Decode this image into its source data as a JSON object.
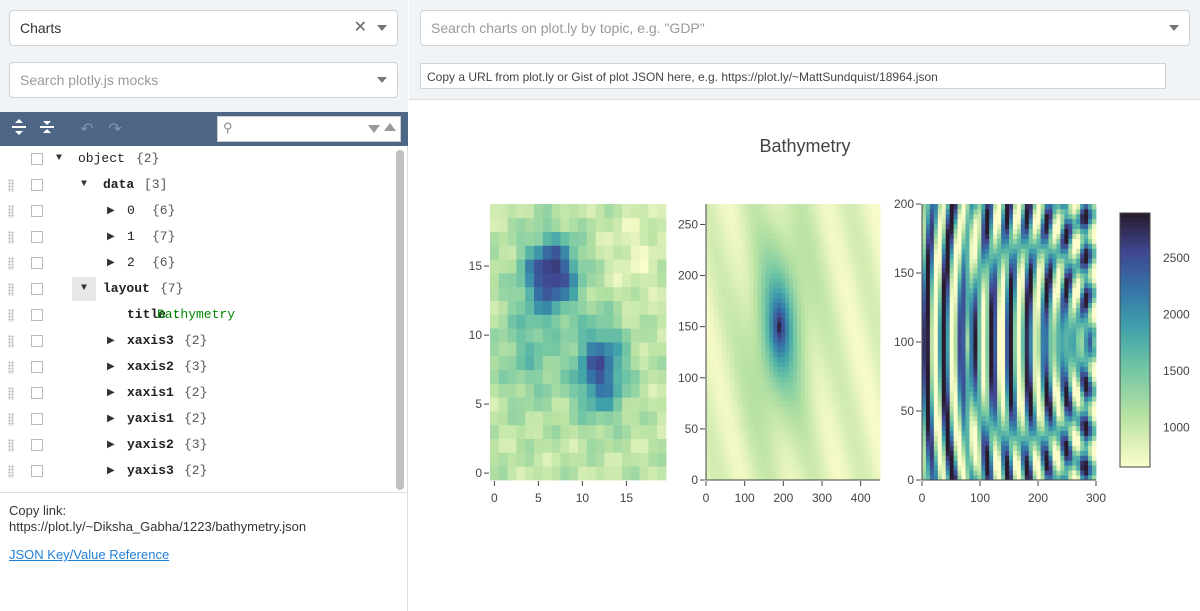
{
  "left": {
    "mode_select": {
      "value": "Charts"
    },
    "mock_search": {
      "placeholder": "Search plotly.js mocks"
    },
    "toolbar": {
      "icons": [
        "expand-all-icon",
        "collapse-all-icon",
        "undo-icon",
        "redo-icon",
        "search-icon"
      ]
    },
    "tree": [
      {
        "key": "object",
        "count": "{2}"
      },
      {
        "key": "data",
        "count": "[3]"
      },
      {
        "key": "0",
        "count": "{6}"
      },
      {
        "key": "1",
        "count": "{7}"
      },
      {
        "key": "2",
        "count": "{6}"
      },
      {
        "key": "layout",
        "count": "{7}"
      },
      {
        "key": "title",
        "sep": ":",
        "value": "Bathymetry"
      },
      {
        "key": "xaxis3",
        "count": "{2}"
      },
      {
        "key": "xaxis2",
        "count": "{3}"
      },
      {
        "key": "xaxis1",
        "count": "{2}"
      },
      {
        "key": "yaxis1",
        "count": "{2}"
      },
      {
        "key": "yaxis2",
        "count": "{3}"
      },
      {
        "key": "yaxis3",
        "count": "{2}"
      }
    ],
    "copy_label": "Copy link:",
    "copy_url": "https://plot.ly/~Diksha_Gabha/1223/bathymetry.json",
    "reference_link": "JSON Key/Value Reference"
  },
  "right": {
    "chart_search": {
      "placeholder": "Search charts on plot.ly by topic, e.g. \"GDP\""
    },
    "url_input": {
      "value": "Copy a URL from plot.ly or Gist of plot JSON here, e.g. https://plot.ly/~MattSundquist/18964.json"
    }
  },
  "colors": {
    "toolbar": "#4d6685",
    "panel": "#f1f4f7",
    "link": "#1f7fd6",
    "string_value": "#008800"
  },
  "chart_data": {
    "type": "heatmap",
    "title": "Bathymetry",
    "colorscale": "deep",
    "colorbar": {
      "range": [
        650,
        2900
      ],
      "ticks": [
        1000,
        1500,
        2000,
        2500
      ]
    },
    "subplots": [
      {
        "name": "heatmap-1",
        "xrange": [
          -0.5,
          19.5
        ],
        "yrange": [
          -0.5,
          19.5
        ],
        "xticks": [
          0,
          5,
          10,
          15
        ],
        "yticks": [
          0,
          5,
          10,
          15
        ],
        "description_values": "20x20 grid; deepest (~2800) around x=6-7,y=14-15 and x=11-12,y=7-8"
      },
      {
        "name": "heatmap-2",
        "xrange": [
          0,
          450
        ],
        "yrange": [
          0,
          270
        ],
        "xticks": [
          0,
          100,
          200,
          300,
          400
        ],
        "yticks": [
          0,
          50,
          100,
          150,
          200,
          250
        ],
        "description_values": "smooth field; deepest (~2800) near x=190,y=150"
      },
      {
        "name": "heatmap-3",
        "xrange": [
          0,
          300
        ],
        "yrange": [
          0,
          200
        ],
        "xticks": [
          0,
          100,
          200,
          300
        ],
        "yticks": [
          0,
          50,
          100,
          150,
          200
        ],
        "description_values": "interference pattern; rings converge near x=80, x=300"
      }
    ]
  }
}
